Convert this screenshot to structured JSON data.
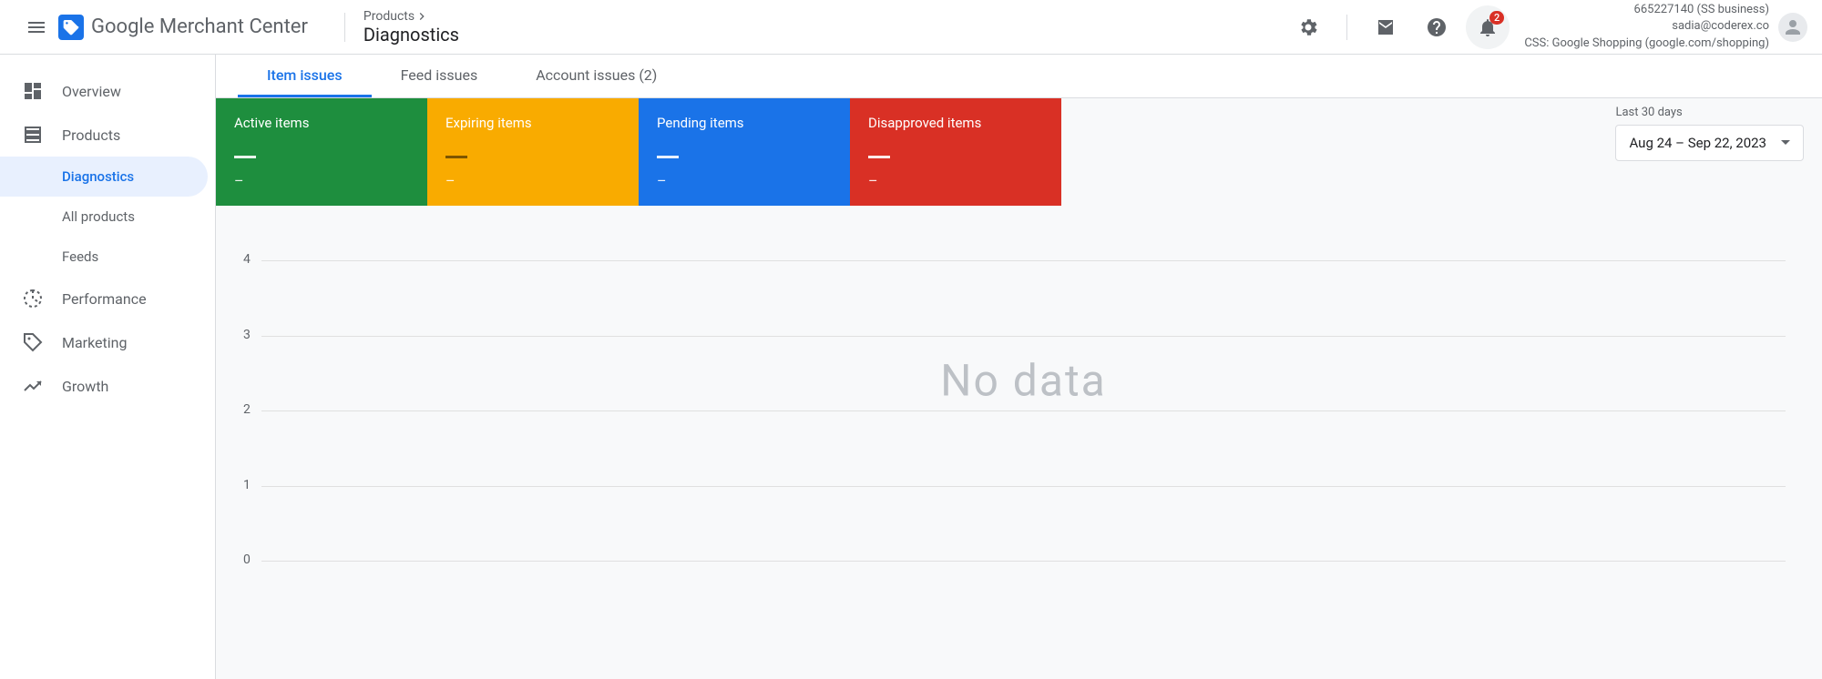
{
  "header": {
    "brand": "Google",
    "product": "Merchant Center",
    "breadcrumb_parent": "Products",
    "page_title": "Diagnostics",
    "notif_count": "2",
    "account_id": "665227140 (SS business)",
    "account_email": "sadia@coderex.co",
    "account_css": "CSS: Google Shopping (google.com/shopping)"
  },
  "sidebar": {
    "overview": "Overview",
    "products": "Products",
    "diagnostics": "Diagnostics",
    "all_products": "All products",
    "feeds": "Feeds",
    "performance": "Performance",
    "marketing": "Marketing",
    "growth": "Growth"
  },
  "tabs": {
    "item": "Item issues",
    "feed": "Feed issues",
    "account": "Account issues (2)"
  },
  "status": {
    "active": "Active items",
    "expiring": "Expiring items",
    "pending": "Pending items",
    "disapproved": "Disapproved items",
    "dash": "–"
  },
  "date": {
    "label": "Last 30 days",
    "range": "Aug 24 – Sep 22, 2023"
  },
  "chart": {
    "no_data": "No data",
    "ticks": {
      "t4": "4",
      "t3": "3",
      "t2": "2",
      "t1": "1",
      "t0": "0"
    }
  }
}
